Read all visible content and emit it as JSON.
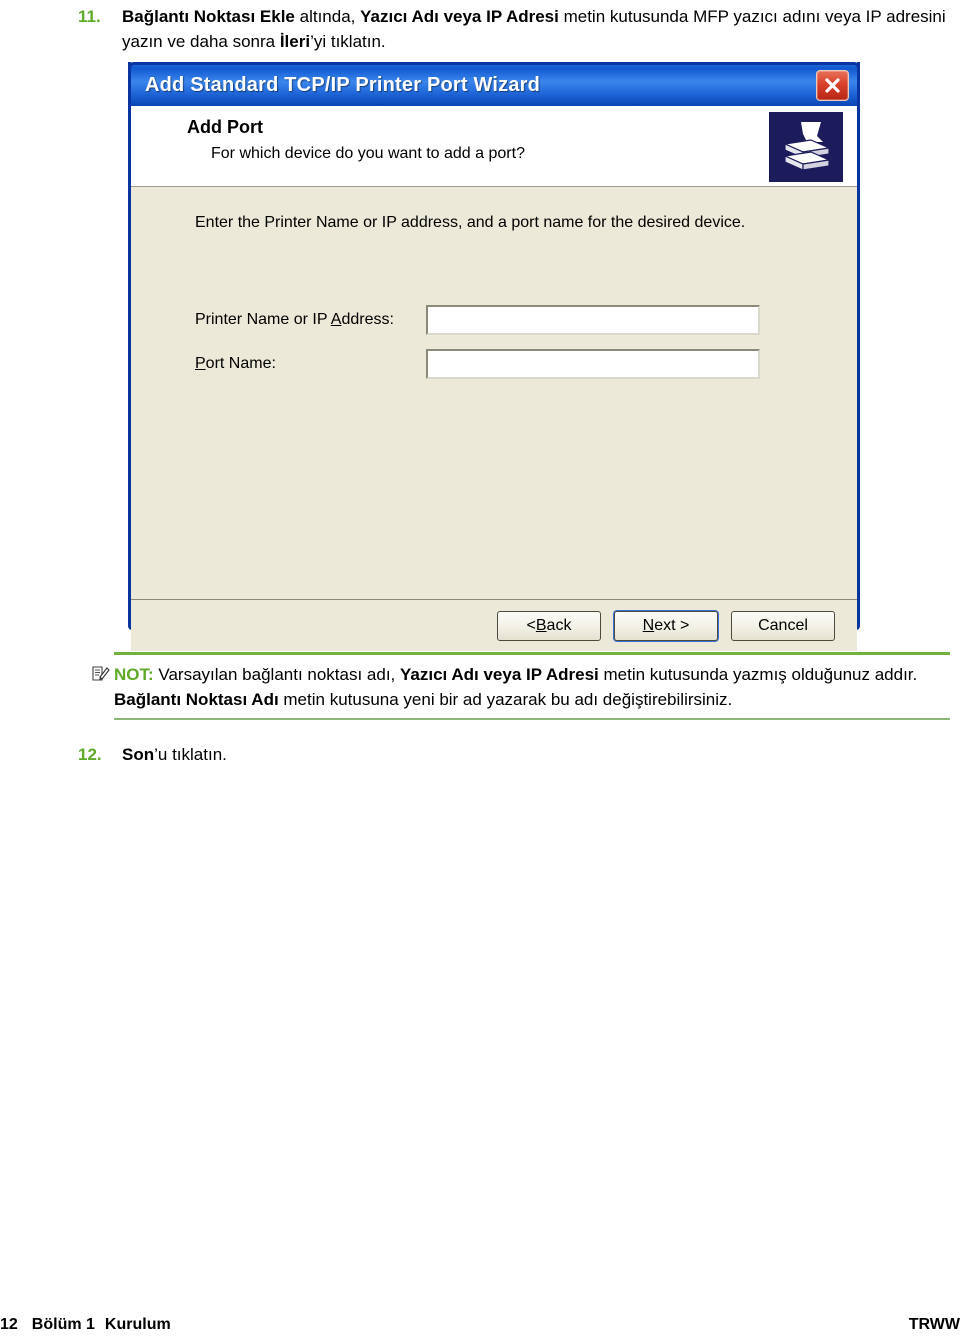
{
  "steps": [
    {
      "number": "11.",
      "segments": [
        {
          "text": "Bağlantı Noktası Ekle",
          "bold": true
        },
        {
          "text": " altında, ",
          "bold": false
        },
        {
          "text": "Yazıcı Adı veya IP Adresi",
          "bold": true
        },
        {
          "text": " metin kutusunda MFP yazıcı adını veya IP adresini yazın ve daha sonra ",
          "bold": false
        },
        {
          "text": "İleri",
          "bold": true
        },
        {
          "text": "’yi tıklatın.",
          "bold": false
        }
      ]
    },
    {
      "number": "12.",
      "segments": [
        {
          "text": "Son",
          "bold": true
        },
        {
          "text": "’u tıklatın.",
          "bold": false
        }
      ]
    }
  ],
  "dialog": {
    "title": "Add Standard TCP/IP Printer Port Wizard",
    "close_icon": "close-icon",
    "header": {
      "title": "Add Port",
      "subtitle": "For which device do you want to add a port?",
      "icon": "printer-icon"
    },
    "body": {
      "intro": "Enter the Printer Name or IP address, and a port name for the desired device.",
      "fields": [
        {
          "label_before": "Printer Name or IP ",
          "label_accel": "A",
          "label_after": "ddress:",
          "value": "",
          "placeholder": ""
        },
        {
          "label_before": "",
          "label_accel": "P",
          "label_after": "ort Name:",
          "value": "",
          "placeholder": ""
        }
      ]
    },
    "buttons": [
      {
        "prefix": "< ",
        "accel": "B",
        "suffix": "ack",
        "default": false
      },
      {
        "prefix": "",
        "accel": "N",
        "suffix": "ext >",
        "default": true
      },
      {
        "prefix": "",
        "accel": "",
        "suffix": "Cancel",
        "default": false
      }
    ]
  },
  "note": {
    "icon": "note-pencil-icon",
    "label": "NOT:",
    "segments": [
      {
        "text": "   Varsayılan bağlantı noktası adı, ",
        "bold": false
      },
      {
        "text": "Yazıcı Adı veya IP Adresi",
        "bold": true
      },
      {
        "text": " metin kutusunda yazmış olduğunuz addır. ",
        "bold": false
      },
      {
        "text": "Bağlantı Noktası Adı",
        "bold": true
      },
      {
        "text": " metin kutusuna yeni bir ad yazarak bu adı değiştirebilirsiniz.",
        "bold": false
      }
    ]
  },
  "footer": {
    "page_number": "12",
    "section": "Bölüm 1",
    "section_title": "Kurulum",
    "brand": "TRWW"
  },
  "colors": {
    "accent_green": "#5faa28",
    "rule_green": "#6fb33b",
    "title_blue": "#1158d0",
    "dialog_border": "#0a34a0",
    "dialog_face": "#ece9d8",
    "icon_navy": "#1c1c5c",
    "close_red": "#d9412a"
  }
}
